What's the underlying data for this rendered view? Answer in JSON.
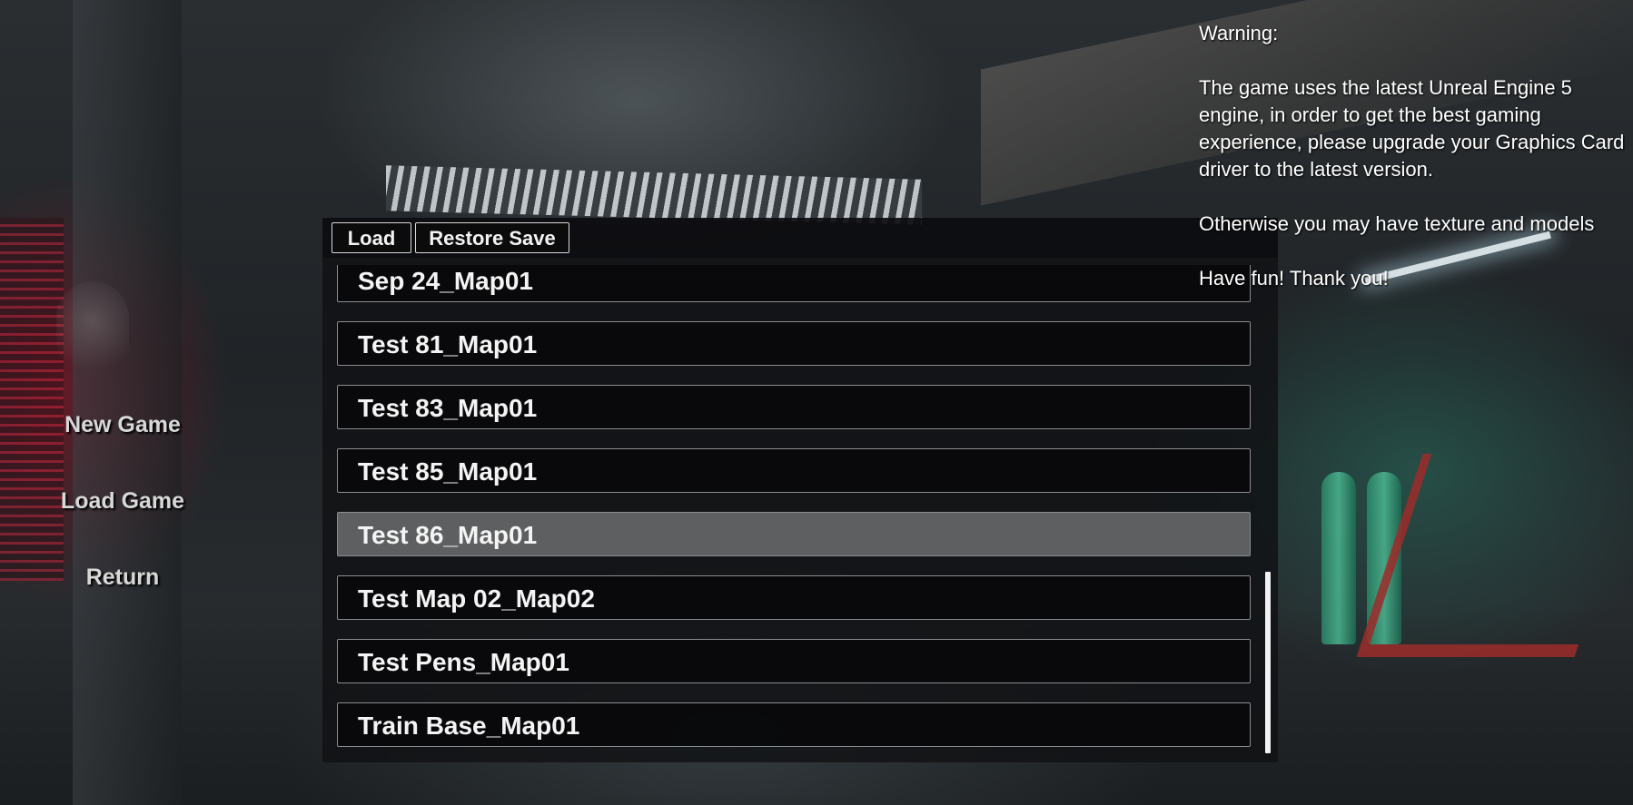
{
  "main_menu": {
    "items": [
      {
        "label": "New Game"
      },
      {
        "label": "Load Game"
      },
      {
        "label": "Return"
      }
    ]
  },
  "load_panel": {
    "load_button": "Load",
    "restore_button": "Restore Save",
    "saves": [
      {
        "label": "Sep 24_Map01",
        "selected": false
      },
      {
        "label": "Test 81_Map01",
        "selected": false
      },
      {
        "label": "Test 83_Map01",
        "selected": false
      },
      {
        "label": "Test 85_Map01",
        "selected": false
      },
      {
        "label": "Test 86_Map01",
        "selected": true
      },
      {
        "label": "Test Map 02_Map02",
        "selected": false
      },
      {
        "label": "Test Pens_Map01",
        "selected": false
      },
      {
        "label": "Train Base_Map01",
        "selected": false
      }
    ]
  },
  "warning": {
    "title": "Warning:",
    "paragraph1": "The game uses the latest Unreal Engine 5 engine, in order to get the best gaming experience, please upgrade your Graphics Card driver to the latest version.",
    "paragraph2": "Otherwise you may have texture and models",
    "closing": "Have fun! Thank you!"
  },
  "colors": {
    "selected_slot": "#5e5f60",
    "slot_border": "#8b8d90",
    "menu_text": "#d8d8d8"
  }
}
